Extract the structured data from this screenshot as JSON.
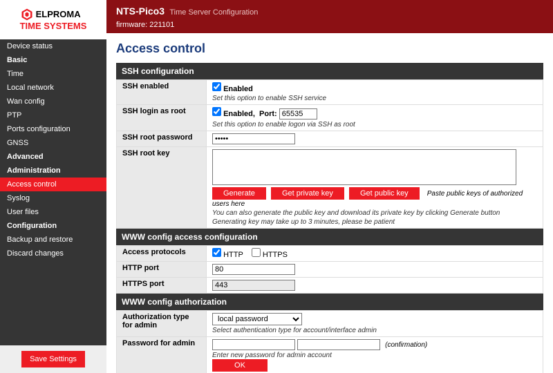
{
  "brand": {
    "line1": "ELPROMA",
    "line2": "TIME SYSTEMS"
  },
  "header": {
    "title": "NTS-Pico3",
    "subtitle": "Time Server Configuration",
    "firmware_prefix": "firmware:",
    "firmware": "221101"
  },
  "page_title": "Access control",
  "save_label": "Save Settings",
  "nav": {
    "device_status": "Device status",
    "basic": "Basic",
    "time": "Time",
    "local_network": "Local network",
    "wan_config": "Wan config",
    "ptp": "PTP",
    "ports_config": "Ports configuration",
    "gnss": "GNSS",
    "advanced": "Advanced",
    "administration": "Administration",
    "access_control": "Access control",
    "syslog": "Syslog",
    "user_files": "User files",
    "configuration": "Configuration",
    "backup_restore": "Backup and restore",
    "discard_changes": "Discard changes"
  },
  "ssh": {
    "section": "SSH configuration",
    "enabled_label": "SSH enabled",
    "enabled_chk": "Enabled",
    "enabled_note": "Set this option to enable SSH service",
    "login_root_label": "SSH login as root",
    "login_root_chk": "Enabled,",
    "port_label": "Port:",
    "port_value": "65535",
    "login_root_note": "Set this option to enable logon via SSH as root",
    "root_pw_label": "SSH root password",
    "root_pw_value": "•••••",
    "root_key_label": "SSH root key",
    "root_key_value": "",
    "gen_btn": "Generate",
    "get_priv_btn": "Get private key",
    "get_pub_btn": "Get public key",
    "paste_note": "Paste public keys of authorized users here",
    "key_note1": "You can also generate the public key and download its private key by clicking Generate button",
    "key_note2": "Generating key may take up to 3 minutes, please be patient"
  },
  "www": {
    "section": "WWW config access configuration",
    "protocols_label": "Access protocols",
    "http_chk": "HTTP",
    "https_chk": "HTTPS",
    "http_port_label": "HTTP port",
    "http_port_value": "80",
    "https_port_label": "HTTPS port",
    "https_port_value": "443"
  },
  "auth": {
    "section": "WWW config authorization",
    "type_label": "Authorization type for admin",
    "type_value": "local password",
    "type_note": "Select authentication type for account/interface admin",
    "pw_label": "Password for admin",
    "confirm_label": "(confirmation)",
    "pw_note": "Enter new password for admin account",
    "ok_btn": "OK"
  }
}
